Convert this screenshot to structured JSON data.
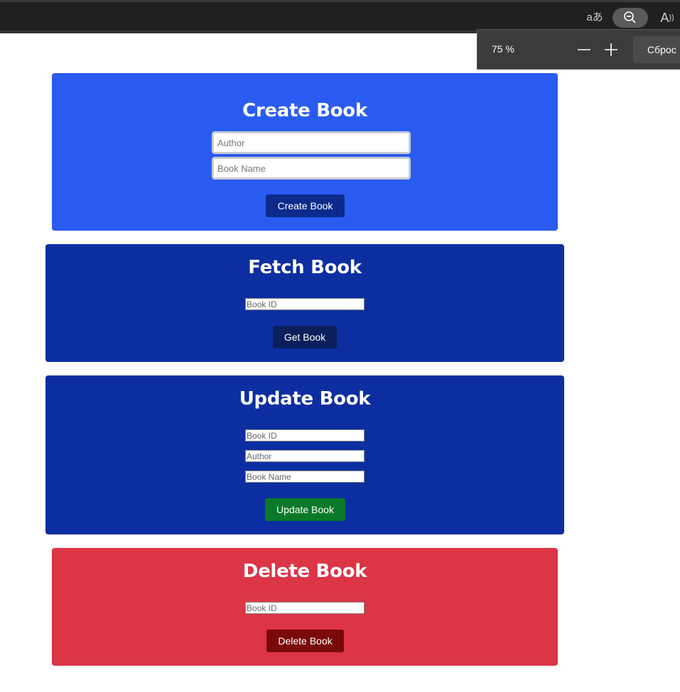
{
  "browser": {
    "toolbar_icons": [
      "translate-icon",
      "zoom-icon",
      "read-aloud-icon"
    ],
    "zoom_popup": {
      "level": "75 %",
      "reset_label": "Сброс"
    }
  },
  "create": {
    "title": "Create Book",
    "author_placeholder": "Author",
    "name_placeholder": "Book Name",
    "button_label": "Create Book",
    "color": "#2a5bf0",
    "button_color": "#0b2a8c"
  },
  "fetch": {
    "title": "Fetch Book",
    "id_placeholder": "Book ID",
    "button_label": "Get Book",
    "color": "#0c2ea0",
    "button_color": "#0b1f5c"
  },
  "update": {
    "title": "Update Book",
    "id_placeholder": "Book ID",
    "author_placeholder": "Author",
    "name_placeholder": "Book Name",
    "button_label": "Update Book",
    "color": "#0c2ea0",
    "button_color": "#0a7a2a"
  },
  "delete": {
    "title": "Delete Book",
    "id_placeholder": "Book ID",
    "button_label": "Delete Book",
    "color": "#dc3545",
    "button_color": "#7a0a0a"
  }
}
